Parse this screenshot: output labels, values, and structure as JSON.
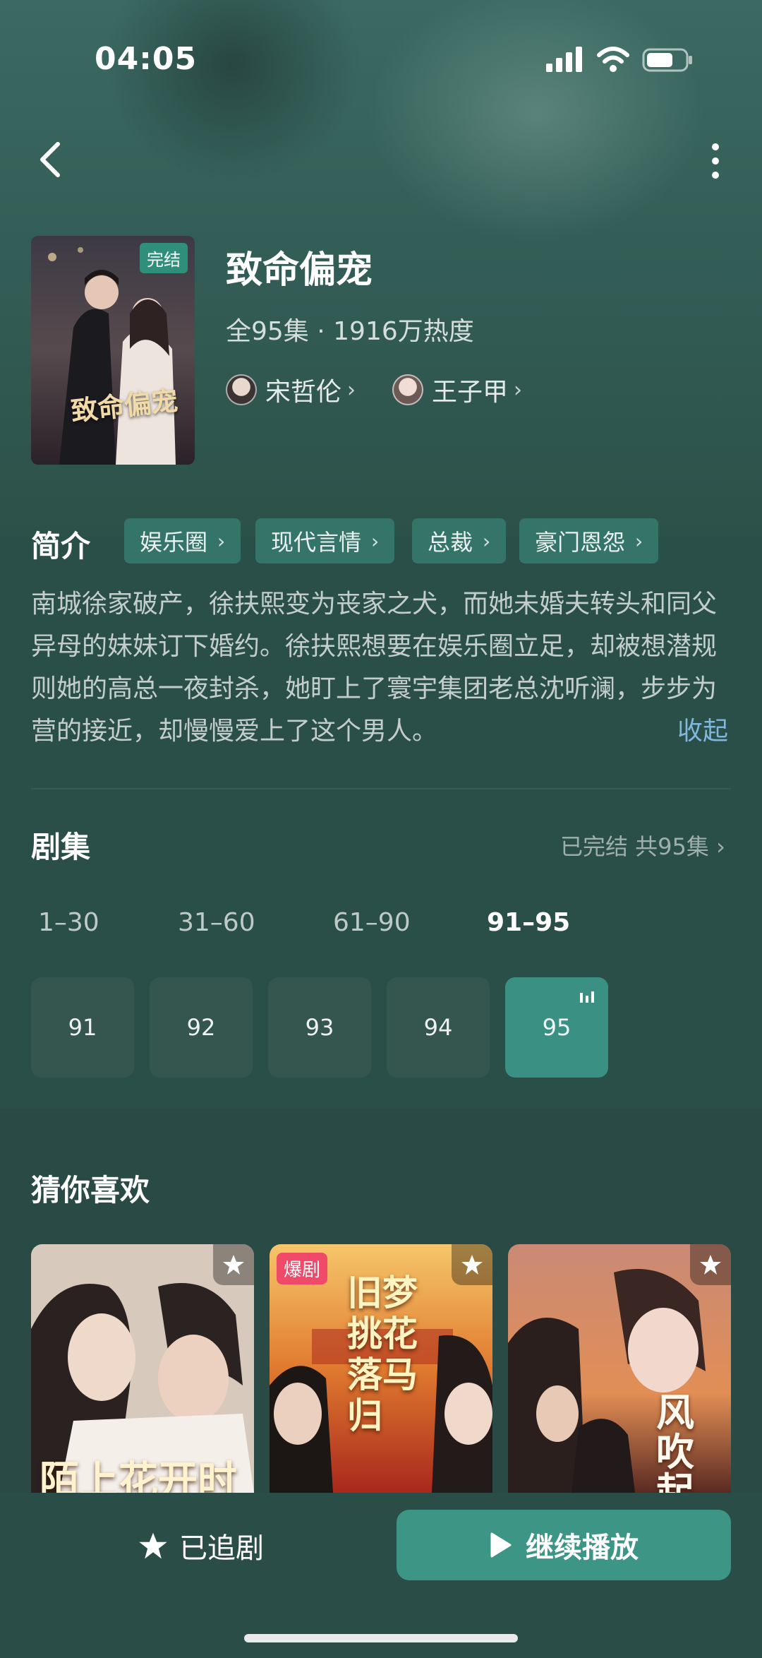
{
  "status_bar": {
    "time": "04:05"
  },
  "drama": {
    "title": "致命偏宠",
    "meta": "全95集 · 1916万热度",
    "poster_badge": "完结",
    "poster_title": "致命偏宠",
    "cast": [
      {
        "name": "宋哲伦"
      },
      {
        "name": "王子甲"
      }
    ]
  },
  "intro": {
    "heading": "简介",
    "tags": [
      "娱乐圈",
      "现代言情",
      "总裁",
      "豪门恩怨"
    ],
    "text": "南城徐家破产，徐扶熙变为丧家之犬，而她未婚夫转头和同父异母的妹妹订下婚约。徐扶熙想要在娱乐圈立足，却被想潜规则她的高总一夜封杀，她盯上了寰宇集团老总沈听澜，步步为营的接近，却慢慢爱上了这个男人。",
    "collapse_label": "收起"
  },
  "episodes": {
    "heading": "剧集",
    "status": "已完结 共95集",
    "ranges": [
      "1–30",
      "31–60",
      "61–90",
      "91–95"
    ],
    "active_range": "91–95",
    "list": [
      "91",
      "92",
      "93",
      "94",
      "95"
    ],
    "playing": "95"
  },
  "recommend": {
    "heading": "猜你喜欢",
    "items": [
      {
        "overlay_title": "陌上花开时"
      },
      {
        "badge": "爆剧",
        "overlay_title": "旧梦挑花落马归"
      },
      {
        "overlay_title": "风吹起"
      }
    ]
  },
  "bottom": {
    "follow_label": "已追剧",
    "play_label": "继续播放"
  },
  "colors": {
    "background": "#2a4e48",
    "accent": "#3d9586",
    "link": "#7fb7dd",
    "hot_badge": "#f04a6a"
  }
}
